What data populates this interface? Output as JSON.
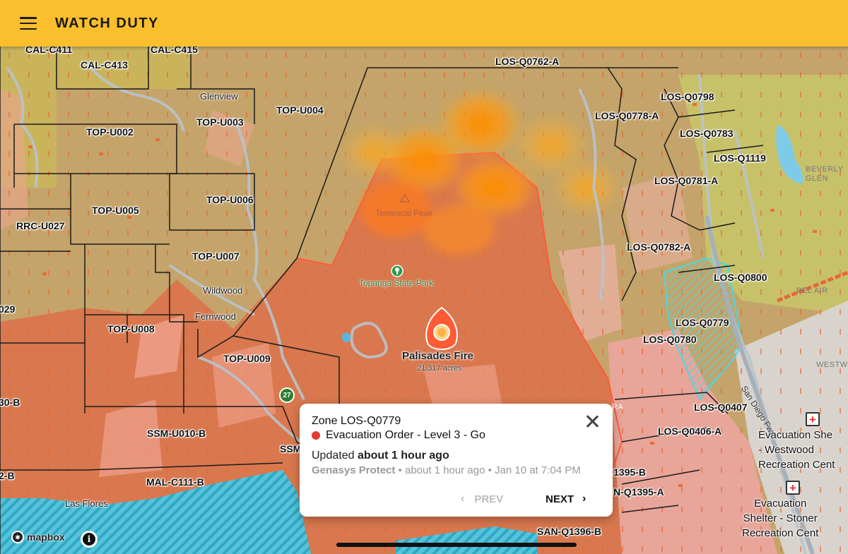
{
  "app": {
    "title": "WATCH DUTY"
  },
  "zones": [
    {
      "name": "CAL-C411"
    },
    {
      "name": "CAL-C415"
    },
    {
      "name": "CAL-C413"
    },
    {
      "name": "LOS-Q0762-A"
    },
    {
      "name": "LOS-Q0798"
    },
    {
      "name": "TOP-U004"
    },
    {
      "name": "LOS-Q0778-A"
    },
    {
      "name": "LOS-Q0783"
    },
    {
      "name": "TOP-U002"
    },
    {
      "name": "TOP-U003"
    },
    {
      "name": "LOS-Q1119"
    },
    {
      "name": "LOS-Q0781-A"
    },
    {
      "name": "TOP-U006"
    },
    {
      "name": "TOP-U005"
    },
    {
      "name": "RRC-U027"
    },
    {
      "name": "LOS-Q0782-A"
    },
    {
      "name": "TOP-U007"
    },
    {
      "name": "LOS-Q0800"
    },
    {
      "name": "029"
    },
    {
      "name": "LOS-Q0779"
    },
    {
      "name": "TOP-U008"
    },
    {
      "name": "LOS-Q0780"
    },
    {
      "name": "TOP-U009"
    },
    {
      "name": "30-B"
    },
    {
      "name": "LOS-Q0407"
    },
    {
      "name": "SSM-U010-B"
    },
    {
      "name": "SSM"
    },
    {
      "name": "LOS-Q0406-A"
    },
    {
      "name": "2-B"
    },
    {
      "name": "MAL-C111-B"
    },
    {
      "name": "1395-B"
    },
    {
      "name": "N-Q1395-A"
    },
    {
      "name": "SAN-Q1396-B"
    }
  ],
  "places": {
    "glenview": "Glenview",
    "wildwood": "Wildwood",
    "fernwood": "Fernwood",
    "las_flores": "Las Flores",
    "beverly_glen": "BEVERLY\nGLEN",
    "bel_air": "BEL AIR",
    "westwood_small": "WESTW",
    "temescal_peak": "Temescal Peak",
    "topanga_park": "Topanga State Park",
    "freeway": "San Diego Fwy",
    "highway": "27",
    "ra": "RA"
  },
  "fire": {
    "name": "Palisades Fire",
    "acres": "21,317 acres"
  },
  "shelters": [
    {
      "label": "Evacuation She\n- Westwood\nRecreation Cent"
    },
    {
      "label": "Evacuation\nShelter - Stoner\nRecreation Cent"
    }
  ],
  "attribution": {
    "logo": "mapbox",
    "info": "i"
  },
  "popup": {
    "title": "Zone LOS-Q0779",
    "status": "Evacuation Order - Level 3 - Go",
    "status_color": "#e53935",
    "updated_prefix": "Updated ",
    "updated_value": "about 1 hour ago",
    "source": "Genasys Protect",
    "source_meta": " • about 1 hour ago • Jan 10 at 7:04 PM",
    "prev_label": "PREV",
    "next_label": "NEXT"
  },
  "colors": {
    "header": "#fbbf2d",
    "evac_order": "#d9784e",
    "evac_warning": "#c4a46a",
    "ocean": "#4fc1d9"
  }
}
